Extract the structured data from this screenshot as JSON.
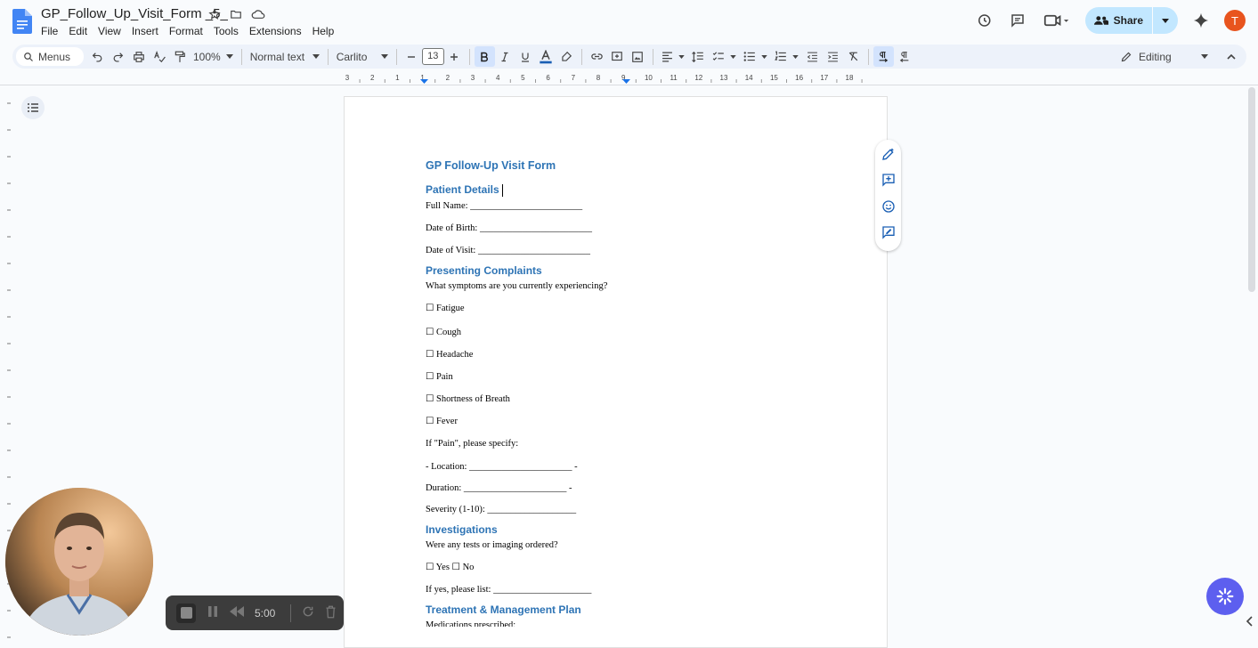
{
  "app": {
    "doc_title": "GP_Follow_Up_Visit_Form _5_",
    "menu": [
      "File",
      "Edit",
      "View",
      "Insert",
      "Format",
      "Tools",
      "Extensions",
      "Help"
    ],
    "share_label": "Share",
    "avatar_letter": "T"
  },
  "toolbar": {
    "search_label": "Menus",
    "zoom": "100%",
    "style": "Normal text",
    "font": "Carlito",
    "font_size": "13",
    "mode": "Editing"
  },
  "ruler": {
    "ticks": [
      "3",
      "2",
      "1",
      "1",
      "2",
      "3",
      "4",
      "5",
      "6",
      "7",
      "8",
      "9",
      "10",
      "11",
      "12",
      "13",
      "14",
      "15",
      "16",
      "17",
      "18"
    ]
  },
  "document": {
    "title": "GP Follow-Up Visit Form",
    "patient_heading": "Patient Details",
    "full_name": "Full Name: ________________________",
    "dob": "Date of Birth: ________________________",
    "dov": "Date of Visit: ________________________",
    "complaints_heading": "Presenting Complaints",
    "symptoms_question": "What symptoms are you currently experiencing?",
    "symptoms": [
      "☐ Fatigue",
      "☐ Cough",
      "☐ Headache",
      "☐ Pain",
      "☐ Shortness of Breath",
      "☐ Fever"
    ],
    "pain_prompt": "If \"Pain\", please specify:",
    "location": "- Location: ______________________ -",
    "duration": "Duration: ______________________ -",
    "severity": "Severity (1-10): ___________________",
    "investigations_heading": "Investigations",
    "tests_question": "Were any tests or imaging ordered?",
    "yes_no": "☐ Yes ☐ No",
    "if_yes": "If yes, please list: _____________________",
    "treatment_heading": "Treatment & Management Plan",
    "partial_line": "Medications prescribed:"
  },
  "recorder": {
    "timer": "5:00"
  },
  "colors": {
    "heading_blue": "#2e74b5",
    "share_bg": "#c2e7ff",
    "avatar_bg": "#e8541e",
    "fab_bg": "#5d5fef"
  }
}
